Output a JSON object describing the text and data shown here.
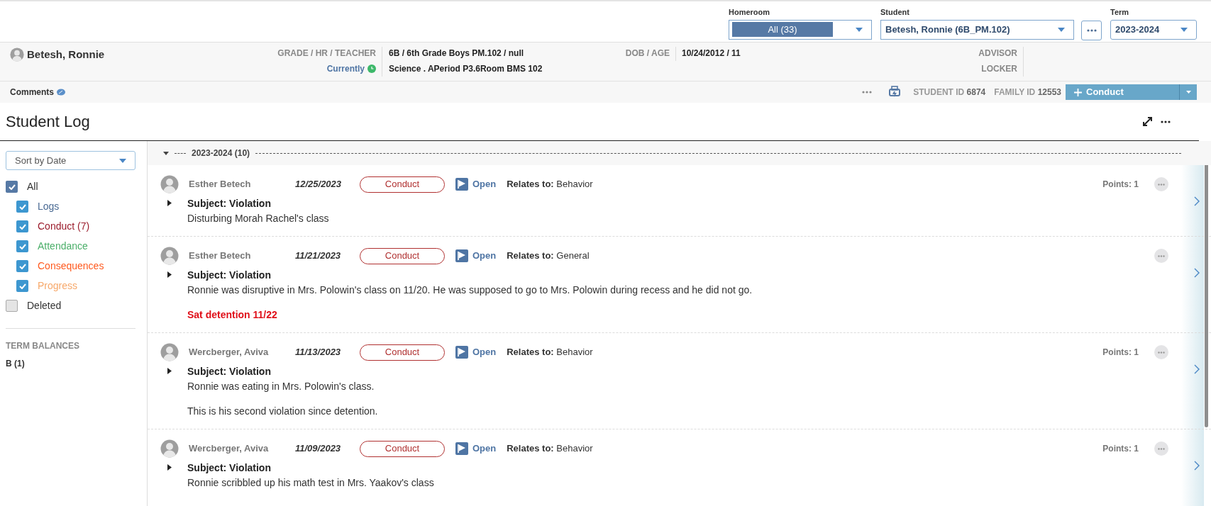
{
  "top_bar": {
    "homeroom": {
      "label": "Homeroom",
      "value": "All (33)"
    },
    "student": {
      "label": "Student",
      "value": "Betesh, Ronnie (6B_PM.102)"
    },
    "term": {
      "label": "Term",
      "value": "2023-2024"
    }
  },
  "student_header": {
    "name": "Betesh, Ronnie",
    "grade_label": "GRADE / HR / TEACHER",
    "grade_value": "6B / 6th Grade Boys PM.102 / null",
    "currently_label": "Currently",
    "currently_value": "Science . APeriod P3.6Room BMS 102",
    "dob_label": "DOB / AGE",
    "dob_value": "10/24/2012 / 11",
    "advisor_label": "ADVISOR",
    "locker_label": "LOCKER"
  },
  "comments_bar": {
    "comments_label": "Comments",
    "student_id_label": "STUDENT ID",
    "student_id": "6874",
    "family_id_label": "FAMILY ID",
    "family_id": "12553",
    "conduct_button": "Conduct"
  },
  "log": {
    "title": "Student Log",
    "sort": "Sort by Date",
    "filters": [
      {
        "label": "All",
        "checked": true,
        "children": [
          {
            "label": "Logs",
            "checked": true,
            "color": "#4a6a93"
          },
          {
            "label": "Conduct (7)",
            "checked": true,
            "color": "#9b1c2c"
          },
          {
            "label": "Attendance",
            "checked": true,
            "color": "#4caf6a"
          },
          {
            "label": "Consequences",
            "checked": true,
            "color": "#ff5a1f"
          },
          {
            "label": "Progress",
            "checked": true,
            "color": "#f7a86a"
          }
        ]
      },
      {
        "label": "Deleted",
        "checked": false
      }
    ],
    "term_balances": {
      "title": "TERM BALANCES",
      "items": [
        "B (1)"
      ]
    },
    "group": {
      "label": "2023-2024 (10)",
      "expanded": true
    },
    "entries": [
      {
        "author": "Esther Betech",
        "date": "12/25/2023",
        "type": "Conduct",
        "status": "Open",
        "relates": "**Relates to:** Behavior",
        "points": "Points: 1",
        "subject": "Subject: Violation",
        "body": [
          "Disturbing Morah Rachel's class"
        ]
      },
      {
        "author": "Esther Betech",
        "date": "11/21/2023",
        "type": "Conduct",
        "status": "Open",
        "relates": "**Relates to:** General",
        "subject": "Subject: Violation",
        "body": [
          "Ronnie was disruptive in Mrs. Polowin's class on 11/20. He was supposed to go to Mrs. Polowin during recess and he did not go."
        ],
        "note": "Sat detention 11/22"
      },
      {
        "author": "Wercberger, Aviva",
        "date": "11/13/2023",
        "type": "Conduct",
        "status": "Open",
        "relates": "**Relates to:** Behavior",
        "points": "Points: 1",
        "subject": "Subject: Violation",
        "body": [
          "Ronnie was eating in Mrs. Polowin's class.",
          "This is his second violation since detention."
        ]
      },
      {
        "author": "Wercberger, Aviva",
        "date": "11/09/2023",
        "type": "Conduct",
        "status": "Open",
        "relates": "**Relates to:** Behavior",
        "points": "Points: 1",
        "subject": "Subject: Violation",
        "body": [
          "Ronnie scribbled up his math test in Mrs. Yaakov's class"
        ]
      }
    ]
  }
}
